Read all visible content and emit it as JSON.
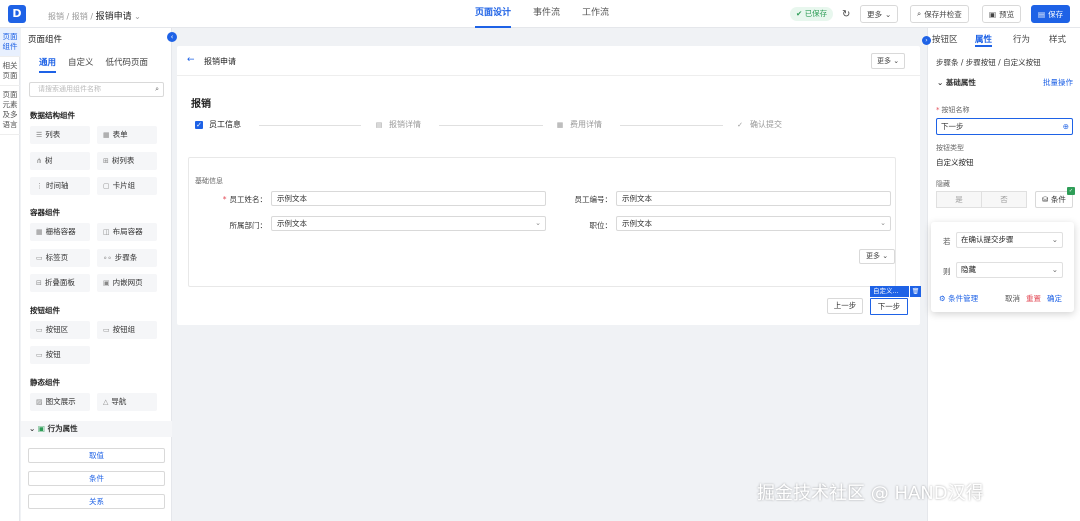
{
  "header": {
    "logo": "D",
    "breadcrumb_parent": "报销 / 报销 /",
    "breadcrumb_current": "报销申请",
    "tabs": [
      "页面设计",
      "事件流",
      "工作流"
    ],
    "saved_label": "已保存",
    "more_label": "更多",
    "save_check_label": "保存并检查",
    "preview_label": "预览",
    "save_label": "保存"
  },
  "rail": [
    "页面组件",
    "相关页面",
    "页面元素及多语言"
  ],
  "left_panel": {
    "title": "页面组件",
    "tabs": [
      "通用",
      "自定义",
      "低代码页面"
    ],
    "search_placeholder": "请搜索通用组件名称",
    "groups": {
      "data": "数据结构组件",
      "container": "容器组件",
      "button": "按钮组件",
      "static": "静态组件"
    },
    "items": [
      "列表",
      "表单",
      "树",
      "树列表",
      "时间轴",
      "卡片组",
      "栅格容器",
      "布局容器",
      "标签页",
      "步骤条",
      "折叠面板",
      "内嵌网页",
      "按钮区",
      "按钮组",
      "按钮",
      "图文展示",
      "导航"
    ],
    "behavior_title": "行为属性",
    "behavior_buttons": [
      "取值",
      "条件",
      "关系"
    ]
  },
  "canvas": {
    "title": "报销申请",
    "more_label": "更多",
    "form_title": "报销",
    "steps": [
      "员工信息",
      "报销详情",
      "费用详情",
      "确认提交"
    ],
    "section_title": "基础信息",
    "fields": {
      "name_label": "员工姓名：",
      "name_value": "示例文本",
      "id_label": "员工编号：",
      "id_value": "示例文本",
      "dept_label": "所属部门：",
      "dept_value": "示例文本",
      "position_label": "职位：",
      "position_value": "示例文本"
    },
    "box_more_label": "更多",
    "prev_label": "上一步",
    "selected_tag": "自定义...",
    "next_label": "下一步"
  },
  "right_panel": {
    "tabs": [
      "按钮区",
      "属性",
      "行为",
      "样式"
    ],
    "breadcrumb": "步骤条 / 步骤按钮 / 自定义按钮",
    "section_title": "基础属性",
    "bulk_label": "批量操作",
    "name_label": "按钮名称",
    "name_value": "下一步",
    "type_label": "按钮类型",
    "type_value": "自定义按钮",
    "hidden_label": "隐藏",
    "yes_label": "是",
    "no_label": "否",
    "condition_label": "条件"
  },
  "popover": {
    "if_label": "若",
    "if_value": "在确认提交步骤",
    "then_label": "则",
    "then_value": "隐藏",
    "manage_label": "条件管理",
    "cancel_label": "取消",
    "reset_label": "重置",
    "ok_label": "确定"
  },
  "watermark": "掘金技术社区 @ HAND汉得",
  "colors": {
    "primary": "#1e62e6",
    "success": "#2e9d57",
    "danger": "#e34d59"
  }
}
